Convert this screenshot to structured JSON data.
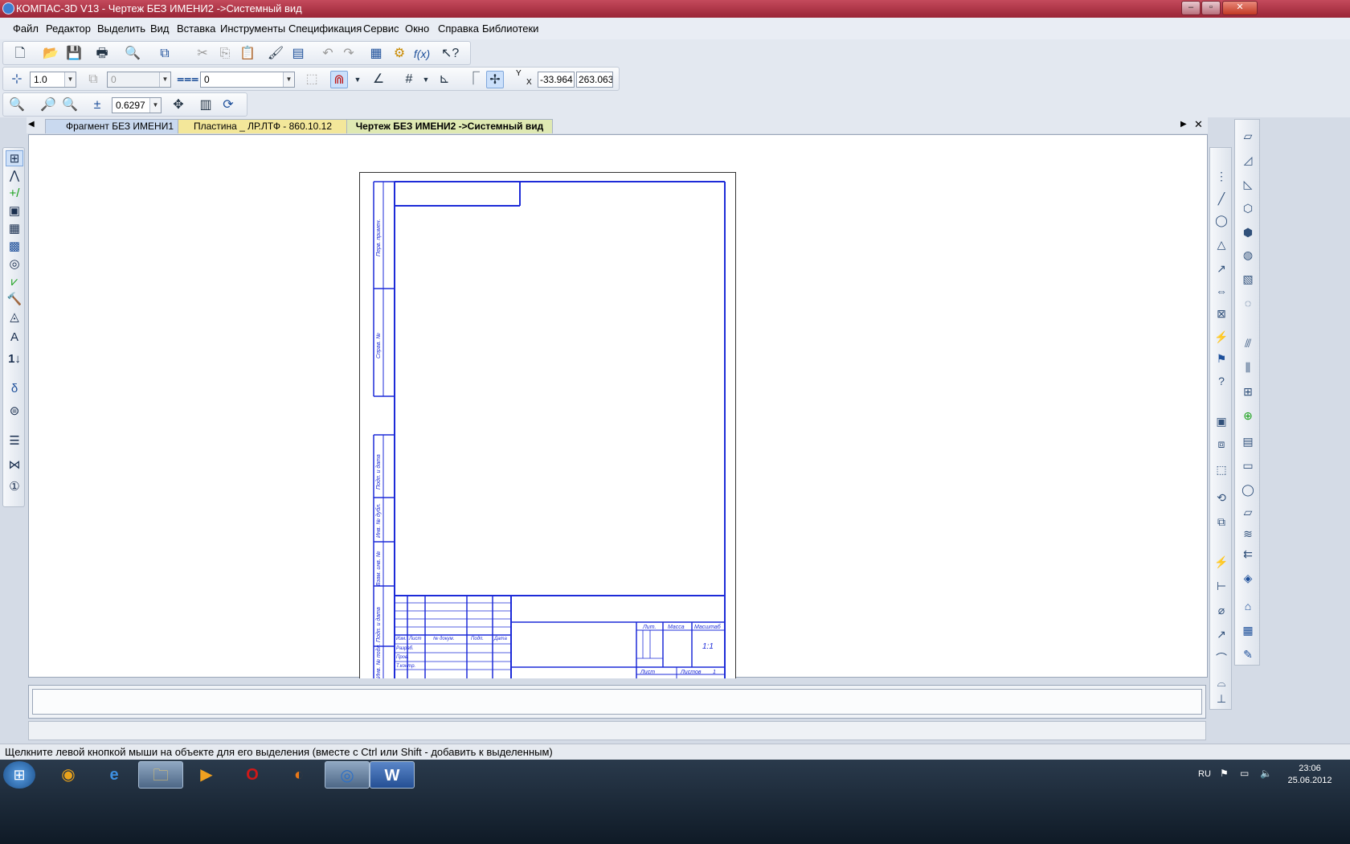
{
  "window": {
    "title": "КОМПАС-3D V13 - Чертеж БЕЗ ИМЕНИ2 ->Системный вид"
  },
  "menu": [
    "Файл",
    "Редактор",
    "Выделить",
    "Вид",
    "Вставка",
    "Инструменты",
    "Спецификация",
    "Сервис",
    "Окно",
    "Справка",
    "Библиотеки"
  ],
  "toolbar2": {
    "step": "1.0",
    "layer_combo": "0",
    "style_combo": "0",
    "coord_y_label": "Y",
    "coord_x_label": "X",
    "coord_x": "-33.964",
    "coord_y": "263.063"
  },
  "toolbar3": {
    "zoom": "0.6297"
  },
  "tabs": [
    {
      "label": "Фрагмент БЕЗ ИМЕНИ1",
      "color": "#c9d9ef"
    },
    {
      "label": "Пластина _ ЛР.ЛТФ - 860.10.12",
      "color": "#f3e79a"
    },
    {
      "label": "Чертеж БЕЗ ИМЕНИ2 ->Системный вид",
      "color": "#dfe9b3"
    }
  ],
  "drawing": {
    "frame_color": "#1d2bd8",
    "side_labels": [
      "Перв. примен.",
      "Справ. №",
      "Подп. и дата",
      "Инв. № дубл.",
      "Взам. инв. №",
      "Подп. и дата",
      "Инв. № подл."
    ],
    "title_headers": {
      "izm": "Изм.",
      "list": "Лист",
      "doc": "№ докум.",
      "podp": "Подп.",
      "data": "Дата",
      "lit": "Лит.",
      "massa": "Масса",
      "masshtab": "Масштаб",
      "sheet": "Лист",
      "sheets": "Листов"
    },
    "title_rows": [
      "Разраб.",
      "Пров.",
      "Т.контр."
    ],
    "scale": "1:1",
    "sheets_count": "1"
  },
  "status": "Щелкните левой кнопкой мыши на объекте для его выделения (вместе с Ctrl или Shift - добавить к выделенным)",
  "taskbar": {
    "lang": "RU",
    "time": "23:06",
    "date": "25.06.2012"
  }
}
